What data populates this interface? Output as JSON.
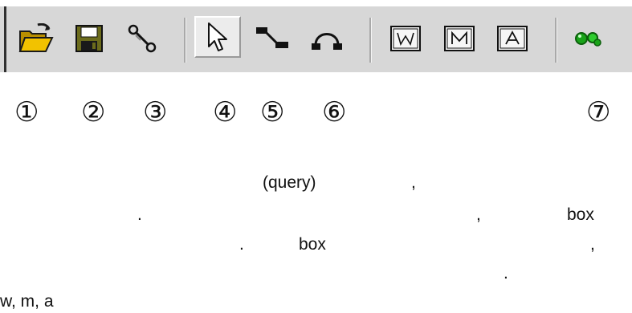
{
  "toolbar": {
    "buttons": [
      {
        "id": "open",
        "icon": "open-folder-icon"
      },
      {
        "id": "save",
        "icon": "floppy-disk-icon"
      },
      {
        "id": "settings",
        "icon": "scissors-icon"
      },
      {
        "id": "select",
        "icon": "mouse-pointer-icon",
        "pressed": true
      },
      {
        "id": "link",
        "icon": "link-connector-icon"
      },
      {
        "id": "arc",
        "icon": "arc-connector-icon"
      },
      {
        "id": "w",
        "icon": "w-box-icon",
        "letter": "W"
      },
      {
        "id": "m",
        "icon": "m-box-icon",
        "letter": "M"
      },
      {
        "id": "a",
        "icon": "a-box-icon",
        "letter": "A"
      },
      {
        "id": "run",
        "icon": "green-go-icon"
      }
    ]
  },
  "markers": [
    "①",
    "②",
    "③",
    "④",
    "⑤",
    "⑥",
    "⑦"
  ],
  "body_text": {
    "t1": "(query)",
    "t2": ",",
    "t3": ".",
    "t4": ",",
    "t5": "box",
    "t6": ".",
    "t7": "box",
    "t8": ",",
    "t9": ".",
    "t10": "w, m, a"
  },
  "colors": {
    "toolbar_bg": "#d7d7d7",
    "folder_yellow": "#f2c200",
    "disk_olive": "#6b6b1c",
    "go_green": "#19a319"
  }
}
